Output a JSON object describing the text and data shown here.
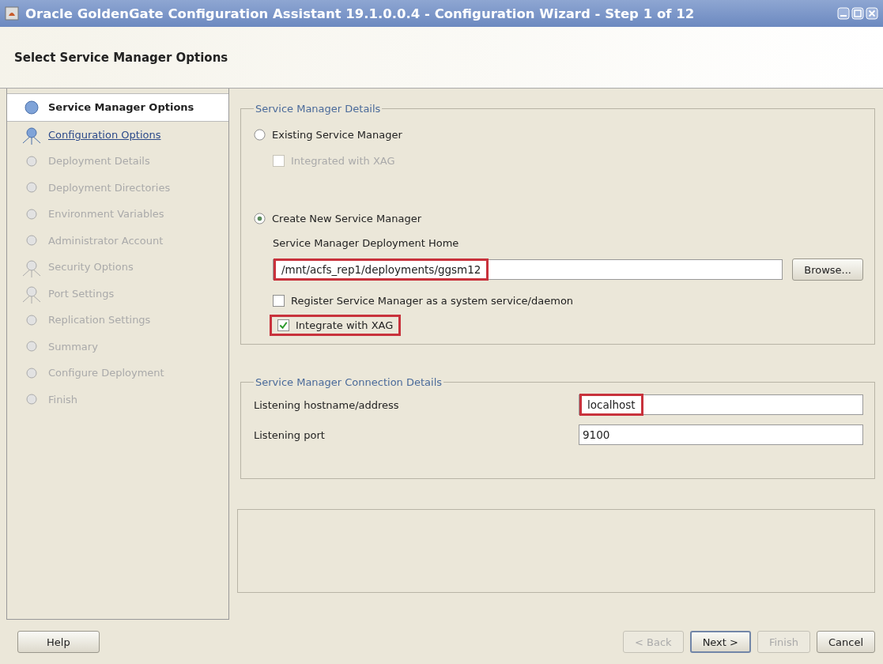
{
  "window": {
    "title": "Oracle GoldenGate Configuration Assistant 19.1.0.0.4 - Configuration Wizard - Step 1 of 12"
  },
  "header": {
    "title": "Select Service Manager Options"
  },
  "steps": [
    {
      "label": "Service Manager Options",
      "kind": "dot",
      "selected": true,
      "disabled": false
    },
    {
      "label": "Configuration Options",
      "kind": "fork",
      "selected": false,
      "disabled": false
    },
    {
      "label": "Deployment Details",
      "kind": "dot",
      "selected": false,
      "disabled": true
    },
    {
      "label": "Deployment Directories",
      "kind": "dot",
      "selected": false,
      "disabled": true
    },
    {
      "label": "Environment Variables",
      "kind": "dot",
      "selected": false,
      "disabled": true
    },
    {
      "label": "Administrator Account",
      "kind": "dot",
      "selected": false,
      "disabled": true
    },
    {
      "label": "Security Options",
      "kind": "fork",
      "selected": false,
      "disabled": true
    },
    {
      "label": "Port Settings",
      "kind": "fork",
      "selected": false,
      "disabled": true
    },
    {
      "label": "Replication Settings",
      "kind": "dot",
      "selected": false,
      "disabled": true
    },
    {
      "label": "Summary",
      "kind": "dot",
      "selected": false,
      "disabled": true
    },
    {
      "label": "Configure Deployment",
      "kind": "dot",
      "selected": false,
      "disabled": true
    },
    {
      "label": "Finish",
      "kind": "dot",
      "selected": false,
      "disabled": true
    }
  ],
  "details": {
    "legend": "Service Manager Details",
    "existing": {
      "label": "Existing Service Manager",
      "selected": false,
      "sub_checkbox": {
        "label": "Integrated with XAG",
        "checked": false,
        "disabled": true
      }
    },
    "create": {
      "label": "Create New Service Manager",
      "selected": true
    },
    "home_label": "Service Manager Deployment Home",
    "home_value": "/mnt/acfs_rep1/deployments/ggsm12",
    "home_highlighted": true,
    "browse": "Browse...",
    "checkboxes": [
      {
        "label": "Register Service Manager as a system service/daemon",
        "checked": false,
        "highlighted": false
      },
      {
        "label": "Integrate with XAG",
        "checked": true,
        "highlighted": true
      }
    ]
  },
  "connection": {
    "legend": "Service Manager Connection Details",
    "fields": [
      {
        "label": "Listening hostname/address",
        "value": "localhost",
        "highlighted": true
      },
      {
        "label": "Listening port",
        "value": "9100",
        "highlighted": false
      }
    ]
  },
  "buttons": [
    {
      "label": "Help",
      "disabled": false,
      "focused": false
    },
    {
      "label": "< Back",
      "disabled": true,
      "focused": false
    },
    {
      "label": "Next >",
      "disabled": false,
      "focused": true
    },
    {
      "label": "Finish",
      "disabled": true,
      "focused": false
    },
    {
      "label": "Cancel",
      "disabled": false,
      "focused": false
    }
  ]
}
